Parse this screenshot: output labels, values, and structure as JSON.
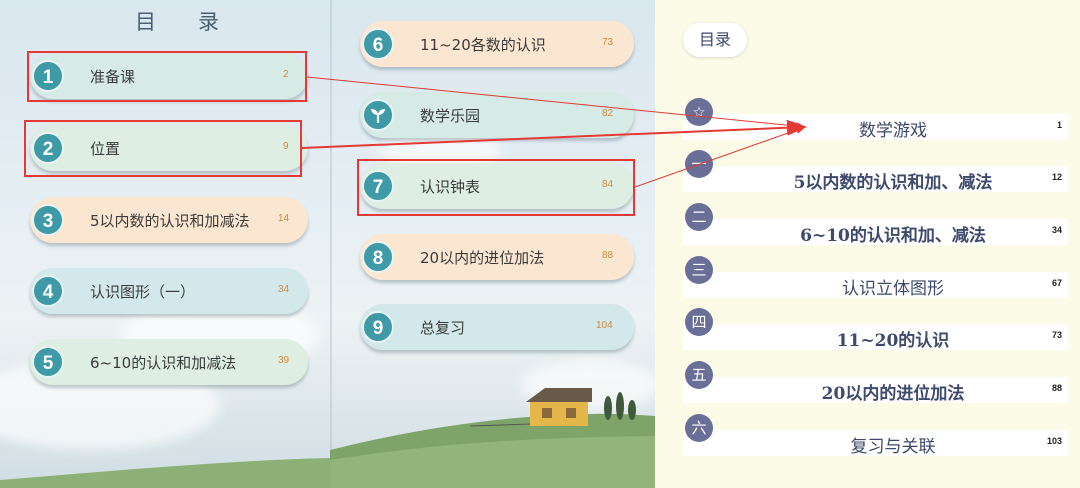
{
  "left_page": {
    "heading": "目录",
    "lessons": [
      {
        "num": "1",
        "title": "准备课",
        "page": "2"
      },
      {
        "num": "2",
        "title": "位置",
        "page": "9"
      },
      {
        "num": "3",
        "title": "5以内数的认识和加减法",
        "page": "14"
      },
      {
        "num": "4",
        "title": "认识图形（一）",
        "page": "34"
      },
      {
        "num": "5",
        "title": "6~10的认识和加减法",
        "page": "39"
      },
      {
        "num": "6",
        "title": "11~20各数的认识",
        "page": "73"
      },
      {
        "num": "",
        "icon": "sprout-icon",
        "title": "数学乐园",
        "page": "82"
      },
      {
        "num": "7",
        "title": "认识钟表",
        "page": "84"
      },
      {
        "num": "8",
        "title": "20以内的进位加法",
        "page": "88"
      },
      {
        "num": "9",
        "title": "总复习",
        "page": "104"
      }
    ]
  },
  "right_page": {
    "tag": "目录",
    "units": [
      {
        "badge": "☆",
        "title": "数学游戏",
        "page": "1"
      },
      {
        "badge": "一",
        "title": "5以内数的认识和加、减法",
        "page": "12"
      },
      {
        "badge": "二",
        "title": "6~10的认识和加、减法",
        "page": "34"
      },
      {
        "badge": "三",
        "title": "认识立体图形",
        "page": "67"
      },
      {
        "badge": "四",
        "title": "11~20的认识",
        "page": "73"
      },
      {
        "badge": "五",
        "title": "20以内的进位加法",
        "page": "88"
      },
      {
        "badge": "六",
        "title": "复习与关联",
        "page": "103"
      }
    ]
  },
  "colors": {
    "accent_teal": "#3d9aa6",
    "annotation_red": "#e53935",
    "unit_badge": "#6a6f98"
  }
}
